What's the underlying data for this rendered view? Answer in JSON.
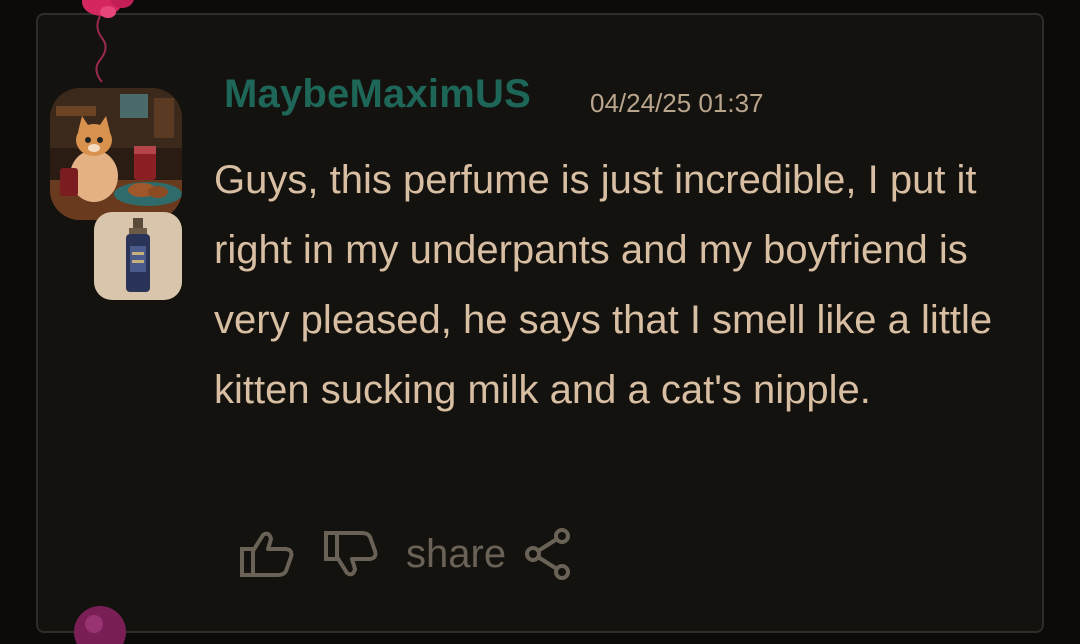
{
  "comment": {
    "username": "MaybeMaximUS",
    "timestamp": "04/24/25 01:37",
    "text": "Guys, this perfume is just incredible, I put it right in my underpants and my boyfriend is very pleased, he says that I smell like a little kitten sucking milk and a cat's nipple.",
    "avatar_icon": "cat-avatar",
    "badge_icon": "perfume-bottle-icon"
  },
  "actions": {
    "share_label": "share",
    "like_icon": "thumbs-up-icon",
    "dislike_icon": "thumbs-down-icon",
    "share_icon": "share-icon"
  },
  "colors": {
    "background": "#0c0b0a",
    "card": "#14120e",
    "username": "#1d6658",
    "text": "#d8bea2",
    "timestamp": "#b9a58d",
    "muted": "#6a6256",
    "balloon": "#d4275f"
  }
}
